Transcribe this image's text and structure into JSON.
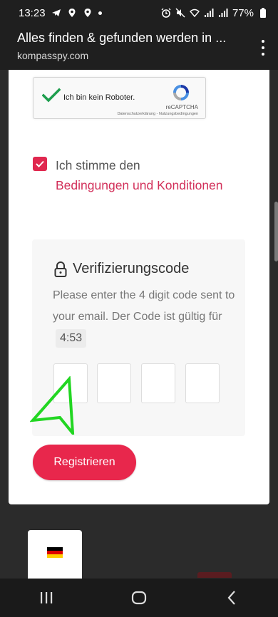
{
  "status_bar": {
    "time": "13:23",
    "battery": "77%",
    "icons": [
      "telegram-icon",
      "location-icon",
      "location-icon",
      "dot",
      "alarm-icon",
      "mute-icon",
      "wifi-icon",
      "signal-icon",
      "signal-icon",
      "battery-icon"
    ]
  },
  "browser": {
    "title": "Alles finden & gefunden werden in ...",
    "url": "kompasspy.com",
    "menu_icon": "kebab-menu-icon"
  },
  "recaptcha": {
    "label": "Ich bin kein Roboter.",
    "brand": "reCAPTCHA",
    "terms": "Datenschutzerklärung - Nutzungsbedingungen",
    "checked": true
  },
  "consent": {
    "prefix": "Ich stimme den",
    "link": "Bedingungen und Konditionen",
    "checked": true,
    "checkbox_color": "#e0284f"
  },
  "verification": {
    "title": "Verifizierungscode",
    "description": "Please enter the 4 digit code sent to your email. Der Code ist gültig für",
    "timer": "4:53",
    "digits": [
      "",
      "",
      "",
      ""
    ]
  },
  "register_label": "Registrieren",
  "colors": {
    "accent": "#e8274c",
    "link": "#d2305a",
    "card_bg": "#ffffff",
    "page_bg": "#2b2b2b"
  },
  "language_flag": "germany-flag",
  "nav": [
    "recent-apps-icon",
    "home-icon",
    "back-icon"
  ]
}
